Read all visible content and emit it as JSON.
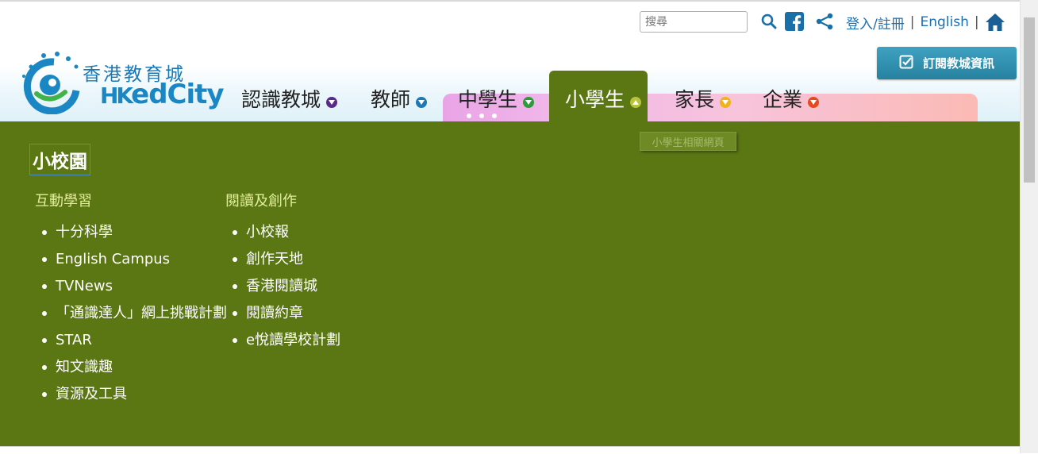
{
  "search": {
    "placeholder": "搜尋"
  },
  "utility": {
    "login_label": "登入/註冊",
    "separator": "|",
    "language_label": "English",
    "icons": [
      "search-icon",
      "facebook-icon",
      "share-icon",
      "home-icon"
    ]
  },
  "subscribe": {
    "label": "訂閱教城資訊",
    "icon": "checkbox-icon"
  },
  "logo": {
    "cn": "香港教育城",
    "en_prefix": "HK",
    "en_suffix": "edCity"
  },
  "nav": {
    "items": [
      {
        "label": "認識教城",
        "arrow_color": "#5a2a8a"
      },
      {
        "label": "教師",
        "arrow_color": "#1e78b4"
      },
      {
        "label": "中學生",
        "arrow_color": "#2e9b3a"
      },
      {
        "label": "小學生",
        "arrow_color": "#b9c43c",
        "active": true
      },
      {
        "label": "家長",
        "arrow_color": "#f2b21c"
      },
      {
        "label": "企業",
        "arrow_color": "#e8481c"
      }
    ]
  },
  "tooltip": {
    "text": "小學生相關網頁"
  },
  "mega": {
    "title": "小校園",
    "columns": [
      {
        "heading": "互動學習",
        "items": [
          "十分科學",
          "English Campus",
          "TVNews",
          "「通識達人」網上挑戰計劃",
          "STAR",
          "知文識趣",
          "資源及工具"
        ]
      },
      {
        "heading": "閱讀及創作",
        "items": [
          "小校報",
          "創作天地",
          "香港閱讀城",
          "閱讀約章",
          "e悅讀學校計劃"
        ]
      }
    ]
  },
  "colors": {
    "menu_bg": "#5b7714",
    "link_blue": "#1c6fb0",
    "heading_yellow": "#e3ee9a"
  }
}
